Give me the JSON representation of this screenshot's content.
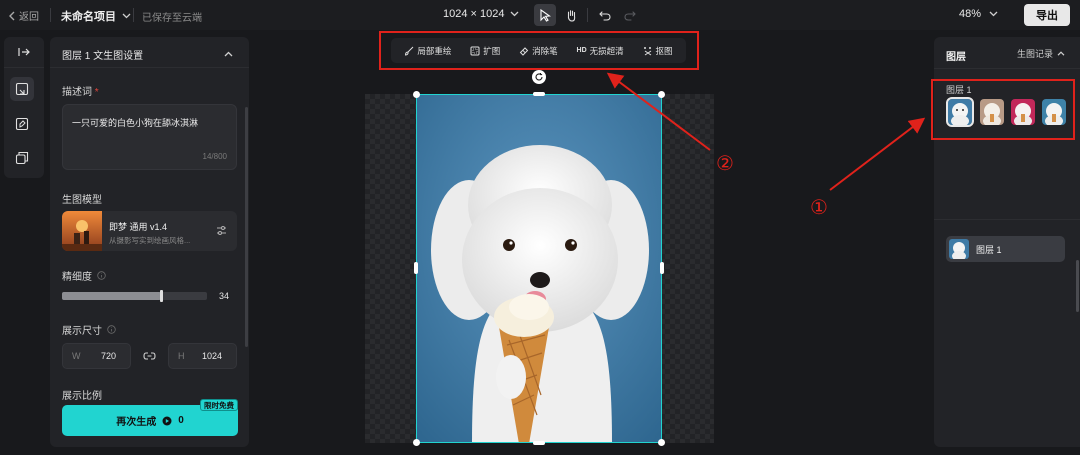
{
  "topbar": {
    "back_label": "返回",
    "project_name": "未命名项目",
    "save_status": "已保存至云端",
    "canvas_size": "1024 × 1024",
    "zoom": "48%",
    "export_label": "导出"
  },
  "left_panel": {
    "title": "图层 1 文生图设置",
    "prompt_label": "描述词",
    "prompt_required": "*",
    "prompt_text": "一只可爱的白色小狗在舔冰淇淋",
    "prompt_count": "14/800",
    "model_label": "生图模型",
    "model_name": "即梦 通用 v1.4",
    "model_desc": "从摄影写实到绘画风格...",
    "detail_label": "精细度",
    "detail_value": "34",
    "detail_fraction": 0.68,
    "size_label": "展示尺寸",
    "width_label": "W",
    "width_value": "720",
    "height_label": "H",
    "height_value": "1024",
    "ratio_label": "展示比例",
    "regen_label": "再次生成",
    "regen_cost": "0",
    "free_badge": "限时免费"
  },
  "canvas_tools": [
    {
      "icon": "brush-icon",
      "label": "局部重绘"
    },
    {
      "icon": "expand-icon",
      "label": "扩图"
    },
    {
      "icon": "eraser-icon",
      "label": "消除笔"
    },
    {
      "icon": "hd-icon",
      "label": "无损超清"
    },
    {
      "icon": "cutout-icon",
      "label": "抠图"
    }
  ],
  "canvas_tools_hd_prefix": "HD",
  "right_panel": {
    "title": "图层",
    "history_label": "生图记录",
    "group_label": "图层 1",
    "layer_name": "图层 1"
  },
  "annotations": {
    "one": "①",
    "two": "②"
  },
  "colors": {
    "accent": "#21d4d0",
    "annotation_red": "#e0221b",
    "canvas_blue": "#3f7ba6"
  }
}
